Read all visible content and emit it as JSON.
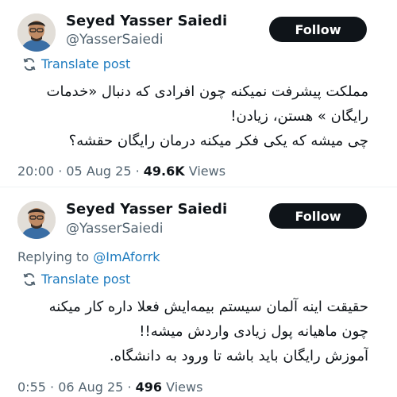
{
  "tweets": [
    {
      "author_name": "Seyed Yasser Saiedi",
      "author_handle": "@YasserSaiedi",
      "follow_label": "Follow",
      "translate_label": "Translate post",
      "body_lines": [
        "مملکت پیشرفت نمیکنه چون افرادی که  دنبال «خدمات",
        "رایگان » هستن، زیادن!",
        "چی میشه که یکی فکر میکنه درمان رایگان حقشه؟"
      ],
      "time": "20:00",
      "date": "05 Aug 25",
      "views_count": "49.6K",
      "views_label": "Views"
    },
    {
      "author_name": "Seyed Yasser Saiedi",
      "author_handle": "@YasserSaiedi",
      "follow_label": "Follow",
      "replying_prefix": "Replying to",
      "replying_handle": "@ImAforrk",
      "translate_label": "Translate post",
      "body_lines": [
        "حقیقت اینه آلمان سیستم بیمه‌ایش فعلا داره کار میکنه",
        "چون ماهیانه پول زیادی واردش میشه!!",
        "آموزش رایگان باید باشه تا ورود به دانشگاه."
      ],
      "time": "0:55",
      "date": "06 Aug 25",
      "views_count": "496",
      "views_label": "Views"
    }
  ],
  "colors": {
    "link": "#1d7bbf",
    "secondary_text": "#536471",
    "button_bg": "#0f1419",
    "button_text": "#ffffff"
  }
}
